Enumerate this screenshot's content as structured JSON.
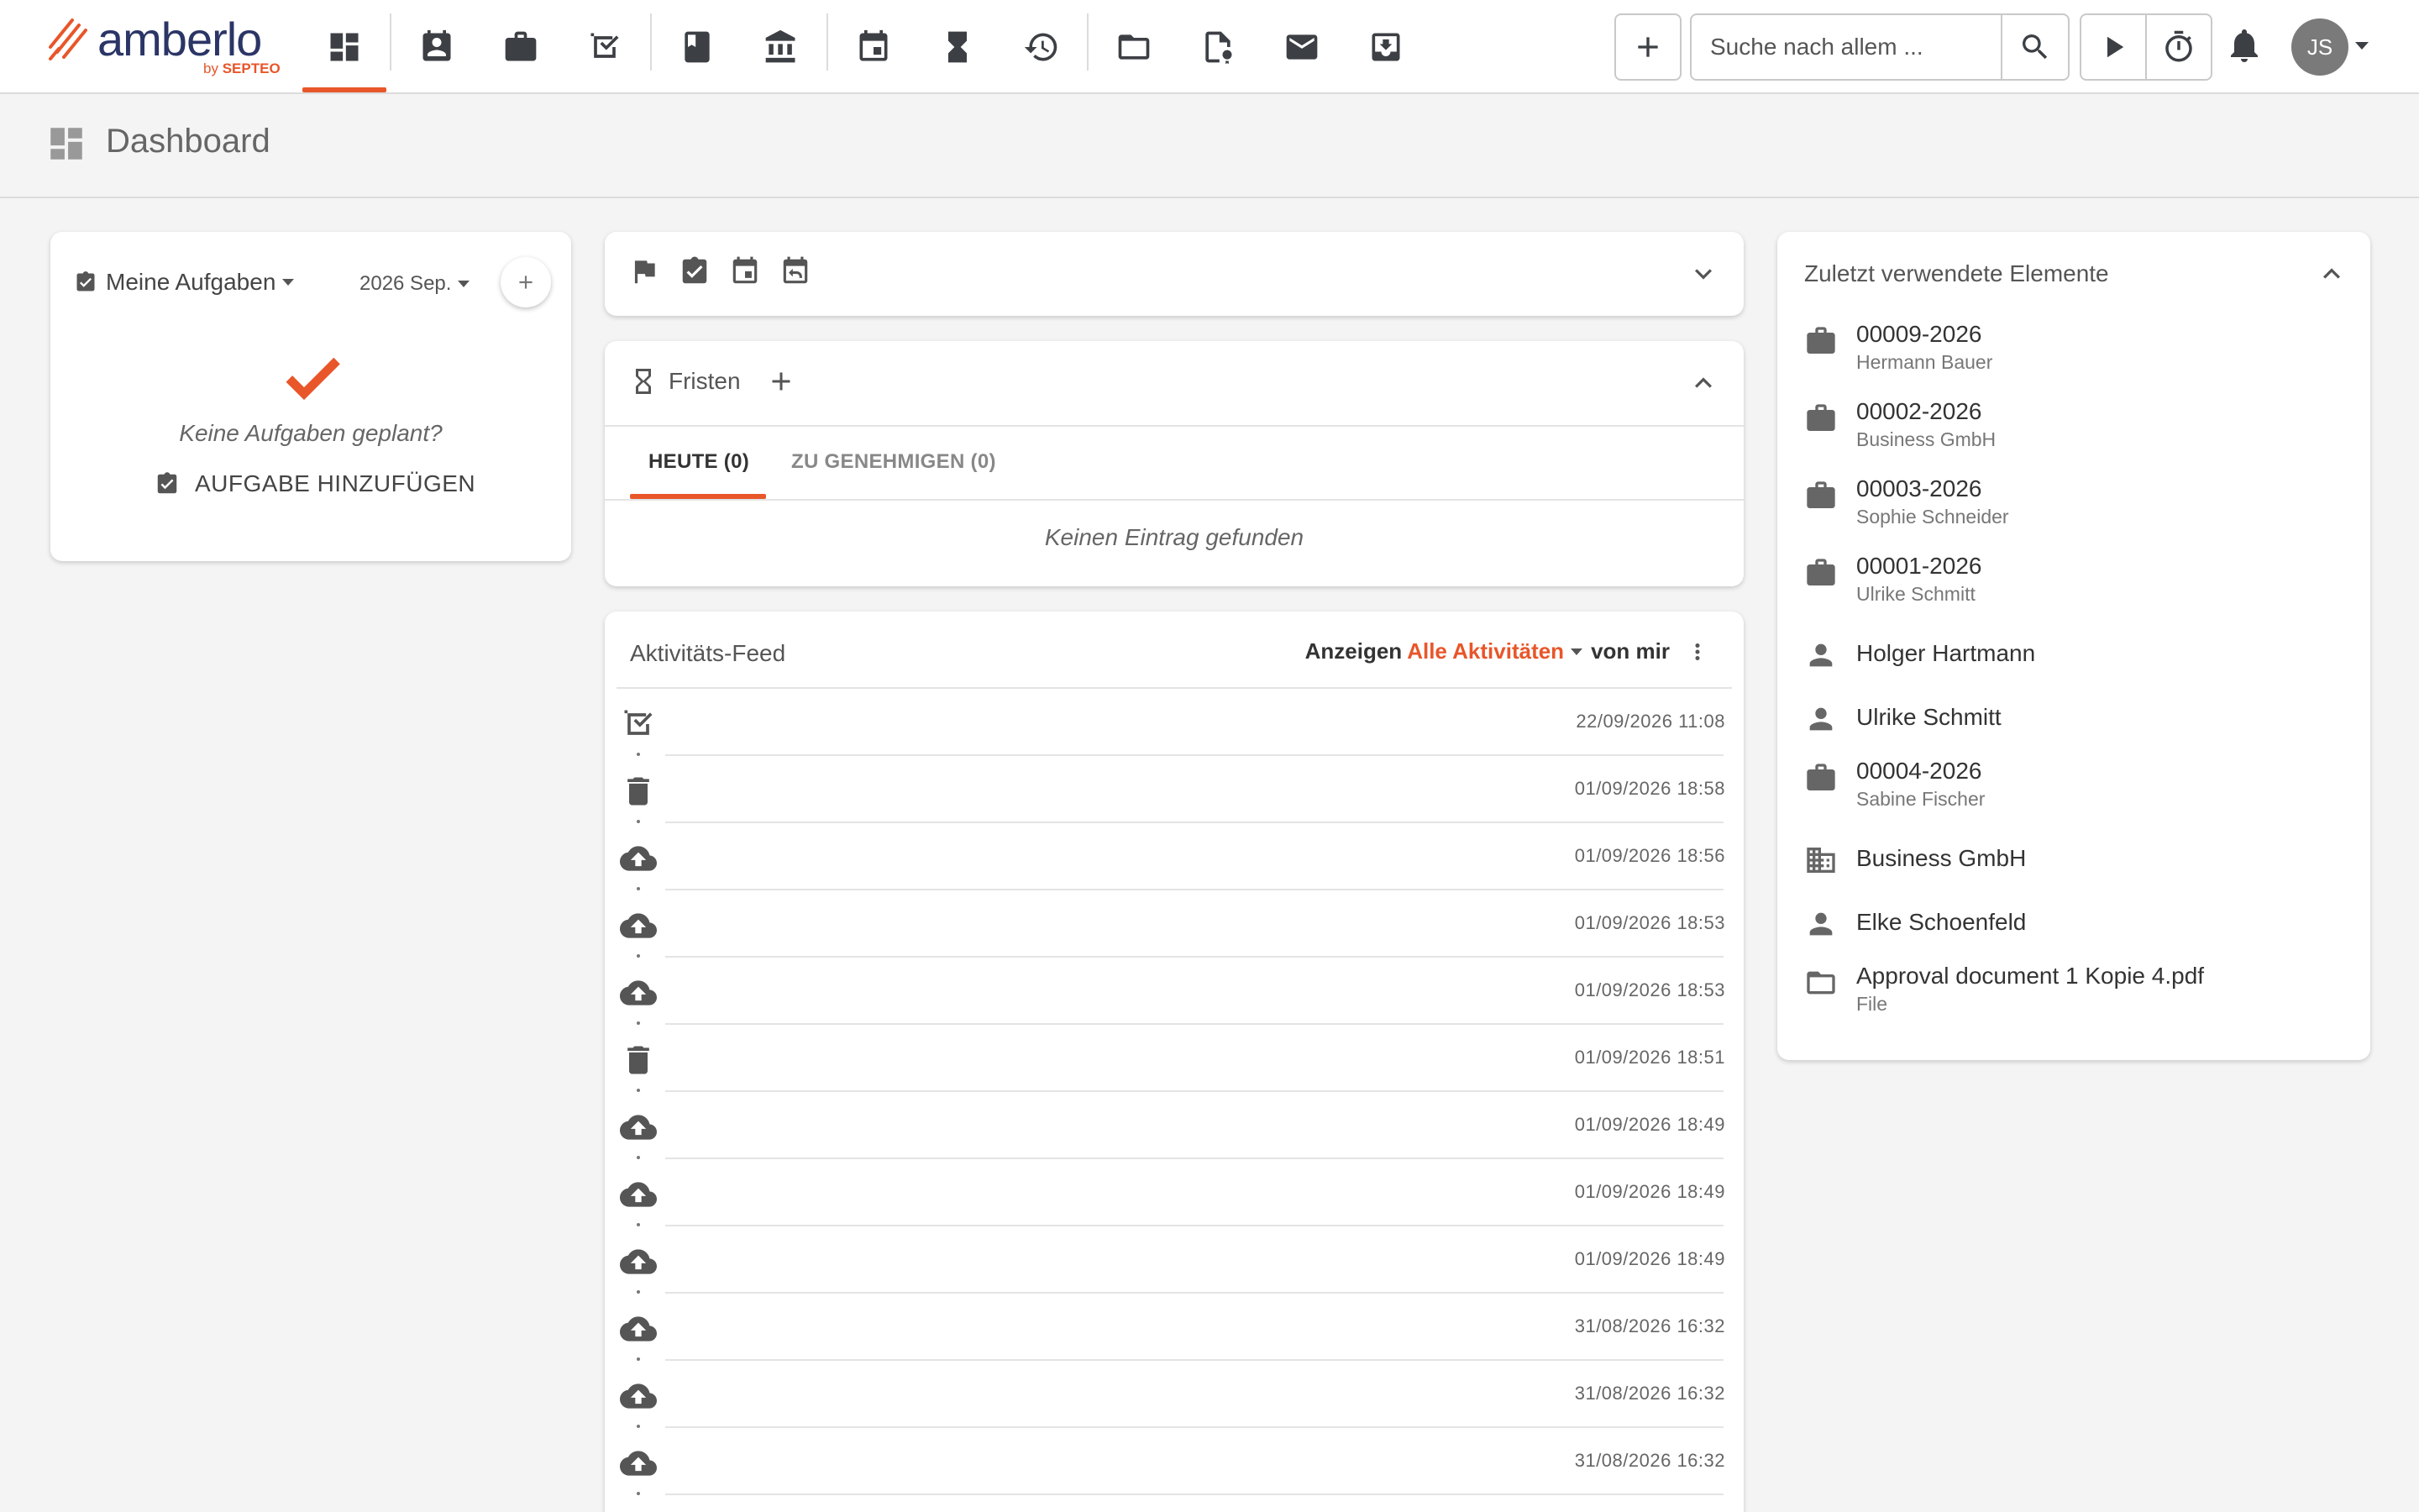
{
  "app": {
    "logo_text": "amberlo",
    "logo_by": "by",
    "logo_brand": "SEPTEO",
    "accent_color": "#e8562a"
  },
  "nav": {
    "items": [
      {
        "name": "dashboard-icon",
        "active": true
      },
      {
        "name": "contacts-icon"
      },
      {
        "name": "matters-icon"
      },
      {
        "name": "tasks-icon"
      },
      {
        "name": "book-icon"
      },
      {
        "name": "bank-icon"
      },
      {
        "name": "calendar-icon"
      },
      {
        "name": "hourglass-icon"
      },
      {
        "name": "billing-icon"
      },
      {
        "name": "folder-icon"
      },
      {
        "name": "document-approval-icon"
      },
      {
        "name": "mail-icon"
      },
      {
        "name": "inbox-icon"
      }
    ]
  },
  "toolbar": {
    "add_icon": "plus-icon",
    "search_placeholder": "Suche nach allem ...",
    "search_icon": "search-icon",
    "play_icon": "play-icon",
    "timer_icon": "stopwatch-icon",
    "bell_icon": "bell-icon",
    "avatar_initials": "JS"
  },
  "page": {
    "title": "Dashboard",
    "icon": "dashboard-icon"
  },
  "tasks": {
    "title": "Meine Aufgaben",
    "month": "2026 Sep.",
    "empty_text": "Keine Aufgaben geplant?",
    "add_label": "AUFGABE HINZUFÜGEN"
  },
  "quick_filters": {
    "icons": [
      "flag-icon",
      "task-icon",
      "event-icon",
      "calendar-reply-icon"
    ]
  },
  "deadlines": {
    "title": "Fristen",
    "tabs": [
      {
        "label": "HEUTE (0)",
        "active": true
      },
      {
        "label": "ZU GENEHMIGEN (0)",
        "active": false
      }
    ],
    "empty_text": "Keinen Eintrag gefunden"
  },
  "feed": {
    "title": "Aktivitäts-Feed",
    "show_label": "Anzeigen",
    "filter_label": "Alle Aktivitäten",
    "scope_label": "von mir",
    "rows": [
      {
        "icon": "task-done-icon",
        "time": "22/09/2026 11:08"
      },
      {
        "icon": "trash-icon",
        "time": "01/09/2026 18:58"
      },
      {
        "icon": "upload-icon",
        "time": "01/09/2026 18:56"
      },
      {
        "icon": "upload-icon",
        "time": "01/09/2026 18:53"
      },
      {
        "icon": "upload-icon",
        "time": "01/09/2026 18:53"
      },
      {
        "icon": "trash-icon",
        "time": "01/09/2026 18:51"
      },
      {
        "icon": "upload-icon",
        "time": "01/09/2026 18:49"
      },
      {
        "icon": "upload-icon",
        "time": "01/09/2026 18:49"
      },
      {
        "icon": "upload-icon",
        "time": "01/09/2026 18:49"
      },
      {
        "icon": "upload-icon",
        "time": "31/08/2026 16:32"
      },
      {
        "icon": "upload-icon",
        "time": "31/08/2026 16:32"
      },
      {
        "icon": "upload-icon",
        "time": "31/08/2026 16:32"
      }
    ]
  },
  "recent": {
    "title": "Zuletzt verwendete Elemente",
    "items": [
      {
        "type": "matter",
        "icon": "briefcase-icon",
        "main": "00009-2026",
        "sub": "Hermann Bauer"
      },
      {
        "type": "matter",
        "icon": "briefcase-icon",
        "main": "00002-2026",
        "sub": "Business GmbH"
      },
      {
        "type": "matter",
        "icon": "briefcase-icon",
        "main": "00003-2026",
        "sub": "Sophie Schneider"
      },
      {
        "type": "matter",
        "icon": "briefcase-icon",
        "main": "00001-2026",
        "sub": "Ulrike Schmitt"
      },
      {
        "type": "person",
        "icon": "person-icon",
        "main": "Holger Hartmann",
        "sub": ""
      },
      {
        "type": "person",
        "icon": "person-icon",
        "main": "Ulrike Schmitt",
        "sub": ""
      },
      {
        "type": "matter",
        "icon": "briefcase-icon",
        "main": "00004-2026",
        "sub": "Sabine Fischer"
      },
      {
        "type": "company",
        "icon": "company-icon",
        "main": "Business GmbH",
        "sub": ""
      },
      {
        "type": "person",
        "icon": "person-icon",
        "main": "Elke Schoenfeld",
        "sub": ""
      },
      {
        "type": "file",
        "icon": "folder-icon",
        "main": "Approval document 1 Kopie 4.pdf",
        "sub": "File"
      }
    ]
  }
}
